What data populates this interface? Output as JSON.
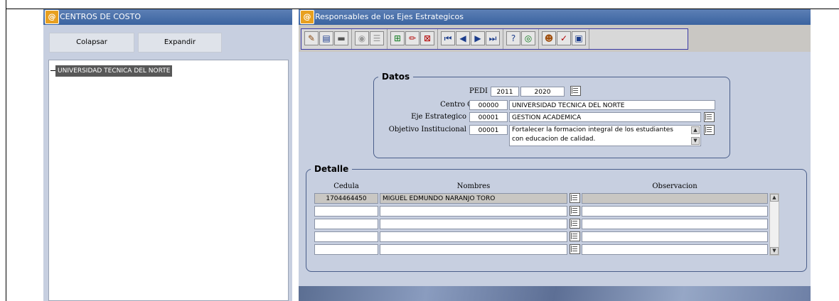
{
  "left_window": {
    "title": "CENTROS DE COSTO",
    "collapse_label": "Colapsar",
    "expand_label": "Expandir",
    "tree_root": "UNIVERSIDAD TECNICA DEL NORTE"
  },
  "right_window": {
    "title": "Responsables de los Ejes Estrategicos",
    "toolbar_icons": [
      "broom-icon",
      "save-icon",
      "print-icon",
      "query-icon",
      "list-icon",
      "insert-record-icon",
      "edit-record-icon",
      "delete-record-icon",
      "first-record-icon",
      "previous-record-icon",
      "next-record-icon",
      "last-record-icon",
      "help-icon",
      "world-icon",
      "user-icon",
      "check-icon",
      "window-icon"
    ],
    "datos": {
      "legend": "Datos",
      "pedi_label": "PEDI",
      "pedi_from": "2011",
      "pedi_dash": "-",
      "pedi_to": "2020",
      "centro_costo_label": "Centro Costo",
      "centro_costo_code": "00000",
      "centro_costo_name": "UNIVERSIDAD TECNICA DEL NORTE",
      "eje_label": "Eje Estrategico",
      "eje_code": "00001",
      "eje_name": "GESTION ACADEMICA",
      "objetivo_label": "Objetivo Institucional",
      "objetivo_code": "00001",
      "objetivo_line1": "Fortalecer la formacion integral de los estudiantes",
      "objetivo_line2": "con educacion de calidad."
    },
    "detalle": {
      "legend": "Detalle",
      "columns": [
        "Cedula",
        "Nombres",
        "Observacion"
      ],
      "rows": [
        {
          "cedula": "1704464450",
          "nombres": "MIGUEL EDMUNDO NARANJO TORO",
          "observacion": ""
        },
        {
          "cedula": "",
          "nombres": "",
          "observacion": ""
        },
        {
          "cedula": "",
          "nombres": "",
          "observacion": ""
        },
        {
          "cedula": "",
          "nombres": "",
          "observacion": ""
        },
        {
          "cedula": "",
          "nombres": "",
          "observacion": ""
        }
      ]
    }
  }
}
